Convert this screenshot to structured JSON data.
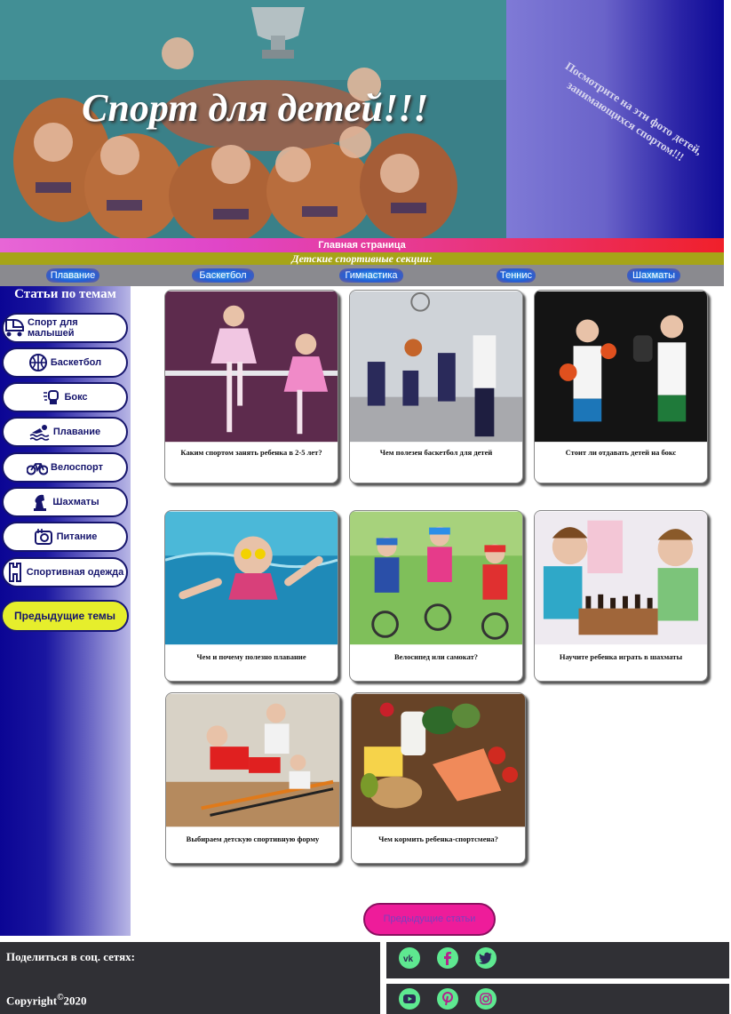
{
  "header": {
    "title": "Спорт для детей!!!",
    "promo": "Посмотрите на эти фото детей, занимающихся спортом!!!"
  },
  "home_link": "Главная страница",
  "sections_title": "Детские спортивные секции:",
  "nav": [
    "Плавание",
    "Баскетбол",
    "Гимнастика",
    "Теннис",
    "Шахматы"
  ],
  "sidebar": {
    "title": "Статьи по темам",
    "items": [
      {
        "label": "Спорт для малышей",
        "icon": "stroller-icon"
      },
      {
        "label": "Баскетбол",
        "icon": "basketball-icon"
      },
      {
        "label": "Бокс",
        "icon": "boxing-glove-icon"
      },
      {
        "label": "Плавание",
        "icon": "swimmer-icon"
      },
      {
        "label": "Велоспорт",
        "icon": "bicycle-icon"
      },
      {
        "label": "Шахматы",
        "icon": "chess-knight-icon"
      },
      {
        "label": "Питание",
        "icon": "food-icon"
      },
      {
        "label": "Спортивная одежда",
        "icon": "clothing-icon"
      }
    ],
    "previous_topics": "Предыдущие темы"
  },
  "articles": [
    {
      "caption": "Каким спортом занять ребенка в 2-5 лет?"
    },
    {
      "caption": "Чем полезен баскетбол для детей"
    },
    {
      "caption": "Стоит ли отдавать детей на бокс"
    },
    {
      "caption": "Чем и почему полезно плавание"
    },
    {
      "caption": "Велосипед или самокат?"
    },
    {
      "caption": "Научите ребенка играть в шахматы"
    },
    {
      "caption": "Выбираем детскую спортивную форму"
    },
    {
      "caption": "Чем кормить ребенка-спортсмена?"
    }
  ],
  "previous_articles": "Предыдущие статьи",
  "footer": {
    "share": "Поделиться в соц. сетях:",
    "copyright_text": "Copyright",
    "copyright_symbol": "©",
    "copyright_year": "2020",
    "social_row1": [
      "vk-icon",
      "facebook-icon",
      "twitter-icon"
    ],
    "social_row2": [
      "youtube-icon",
      "pinterest-icon",
      "instagram-icon"
    ]
  },
  "colors": {
    "accent_pink": "#ee1c9a",
    "sidebar_blue": "#0b0594",
    "button_yellow": "#e6ee2c",
    "social_green": "#5ee890",
    "footer_dark": "#303035"
  }
}
